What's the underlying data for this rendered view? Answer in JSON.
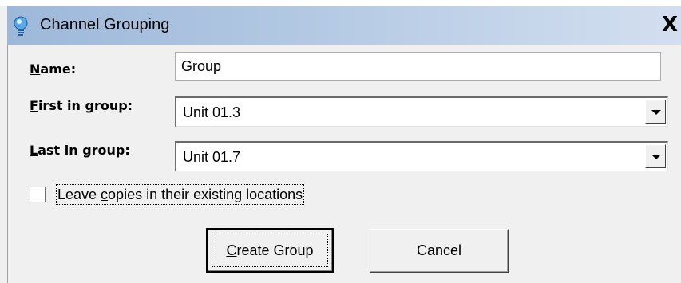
{
  "window": {
    "title": "Channel Grouping",
    "icon": "lightbulb-icon",
    "close_symbol": "X"
  },
  "form": {
    "name_label_key": "N",
    "name_label_rest": "ame:",
    "name_value": "Group",
    "first_label_key": "F",
    "first_label_rest": "irst in group:",
    "first_value": "Unit 01.3",
    "last_label_key": "L",
    "last_label_rest": "ast in group:",
    "last_value": "Unit 01.7",
    "checkbox_label_pre": "Leave ",
    "checkbox_label_key": "c",
    "checkbox_label_post": "opies in their existing locations",
    "checkbox_checked": false
  },
  "buttons": {
    "create_key": "C",
    "create_rest": "reate Group",
    "cancel": "Cancel"
  },
  "colors": {
    "title_gradient_start": "#9db8d9",
    "title_gradient_end": "#d3dff0",
    "dialog_bg": "#f0f0f0"
  }
}
